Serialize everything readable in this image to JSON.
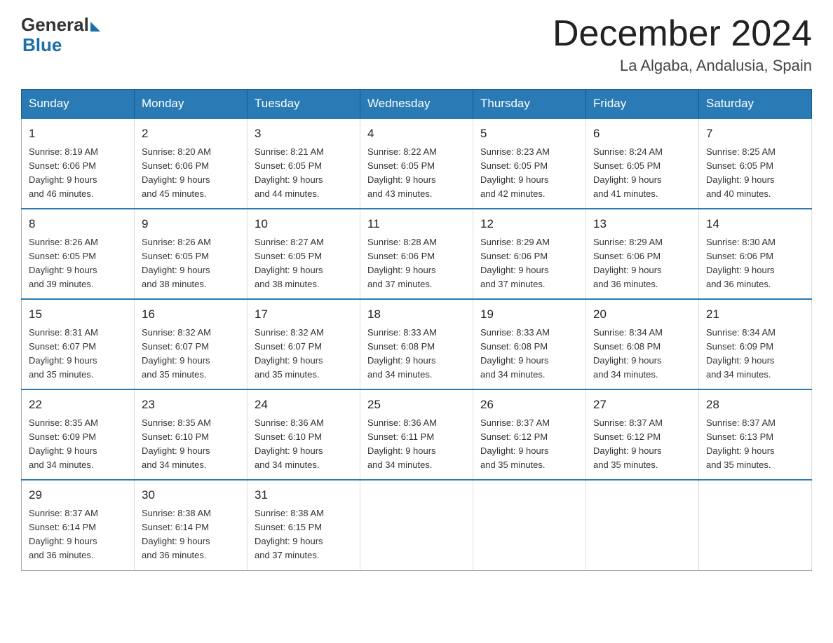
{
  "header": {
    "logo": {
      "general": "General",
      "blue": "Blue"
    },
    "title": "December 2024",
    "location": "La Algaba, Andalusia, Spain"
  },
  "calendar": {
    "days_of_week": [
      "Sunday",
      "Monday",
      "Tuesday",
      "Wednesday",
      "Thursday",
      "Friday",
      "Saturday"
    ],
    "weeks": [
      [
        {
          "day": "1",
          "sunrise": "8:19 AM",
          "sunset": "6:06 PM",
          "daylight": "9 hours and 46 minutes."
        },
        {
          "day": "2",
          "sunrise": "8:20 AM",
          "sunset": "6:06 PM",
          "daylight": "9 hours and 45 minutes."
        },
        {
          "day": "3",
          "sunrise": "8:21 AM",
          "sunset": "6:05 PM",
          "daylight": "9 hours and 44 minutes."
        },
        {
          "day": "4",
          "sunrise": "8:22 AM",
          "sunset": "6:05 PM",
          "daylight": "9 hours and 43 minutes."
        },
        {
          "day": "5",
          "sunrise": "8:23 AM",
          "sunset": "6:05 PM",
          "daylight": "9 hours and 42 minutes."
        },
        {
          "day": "6",
          "sunrise": "8:24 AM",
          "sunset": "6:05 PM",
          "daylight": "9 hours and 41 minutes."
        },
        {
          "day": "7",
          "sunrise": "8:25 AM",
          "sunset": "6:05 PM",
          "daylight": "9 hours and 40 minutes."
        }
      ],
      [
        {
          "day": "8",
          "sunrise": "8:26 AM",
          "sunset": "6:05 PM",
          "daylight": "9 hours and 39 minutes."
        },
        {
          "day": "9",
          "sunrise": "8:26 AM",
          "sunset": "6:05 PM",
          "daylight": "9 hours and 38 minutes."
        },
        {
          "day": "10",
          "sunrise": "8:27 AM",
          "sunset": "6:05 PM",
          "daylight": "9 hours and 38 minutes."
        },
        {
          "day": "11",
          "sunrise": "8:28 AM",
          "sunset": "6:06 PM",
          "daylight": "9 hours and 37 minutes."
        },
        {
          "day": "12",
          "sunrise": "8:29 AM",
          "sunset": "6:06 PM",
          "daylight": "9 hours and 37 minutes."
        },
        {
          "day": "13",
          "sunrise": "8:29 AM",
          "sunset": "6:06 PM",
          "daylight": "9 hours and 36 minutes."
        },
        {
          "day": "14",
          "sunrise": "8:30 AM",
          "sunset": "6:06 PM",
          "daylight": "9 hours and 36 minutes."
        }
      ],
      [
        {
          "day": "15",
          "sunrise": "8:31 AM",
          "sunset": "6:07 PM",
          "daylight": "9 hours and 35 minutes."
        },
        {
          "day": "16",
          "sunrise": "8:32 AM",
          "sunset": "6:07 PM",
          "daylight": "9 hours and 35 minutes."
        },
        {
          "day": "17",
          "sunrise": "8:32 AM",
          "sunset": "6:07 PM",
          "daylight": "9 hours and 35 minutes."
        },
        {
          "day": "18",
          "sunrise": "8:33 AM",
          "sunset": "6:08 PM",
          "daylight": "9 hours and 34 minutes."
        },
        {
          "day": "19",
          "sunrise": "8:33 AM",
          "sunset": "6:08 PM",
          "daylight": "9 hours and 34 minutes."
        },
        {
          "day": "20",
          "sunrise": "8:34 AM",
          "sunset": "6:08 PM",
          "daylight": "9 hours and 34 minutes."
        },
        {
          "day": "21",
          "sunrise": "8:34 AM",
          "sunset": "6:09 PM",
          "daylight": "9 hours and 34 minutes."
        }
      ],
      [
        {
          "day": "22",
          "sunrise": "8:35 AM",
          "sunset": "6:09 PM",
          "daylight": "9 hours and 34 minutes."
        },
        {
          "day": "23",
          "sunrise": "8:35 AM",
          "sunset": "6:10 PM",
          "daylight": "9 hours and 34 minutes."
        },
        {
          "day": "24",
          "sunrise": "8:36 AM",
          "sunset": "6:10 PM",
          "daylight": "9 hours and 34 minutes."
        },
        {
          "day": "25",
          "sunrise": "8:36 AM",
          "sunset": "6:11 PM",
          "daylight": "9 hours and 34 minutes."
        },
        {
          "day": "26",
          "sunrise": "8:37 AM",
          "sunset": "6:12 PM",
          "daylight": "9 hours and 35 minutes."
        },
        {
          "day": "27",
          "sunrise": "8:37 AM",
          "sunset": "6:12 PM",
          "daylight": "9 hours and 35 minutes."
        },
        {
          "day": "28",
          "sunrise": "8:37 AM",
          "sunset": "6:13 PM",
          "daylight": "9 hours and 35 minutes."
        }
      ],
      [
        {
          "day": "29",
          "sunrise": "8:37 AM",
          "sunset": "6:14 PM",
          "daylight": "9 hours and 36 minutes."
        },
        {
          "day": "30",
          "sunrise": "8:38 AM",
          "sunset": "6:14 PM",
          "daylight": "9 hours and 36 minutes."
        },
        {
          "day": "31",
          "sunrise": "8:38 AM",
          "sunset": "6:15 PM",
          "daylight": "9 hours and 37 minutes."
        },
        null,
        null,
        null,
        null
      ]
    ]
  },
  "labels": {
    "sunrise": "Sunrise:",
    "sunset": "Sunset:",
    "daylight": "Daylight:"
  }
}
